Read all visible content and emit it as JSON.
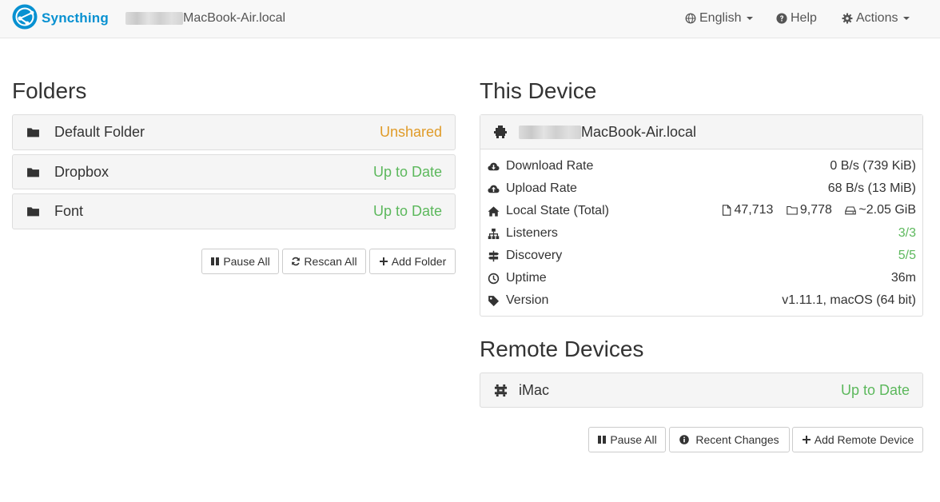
{
  "navbar": {
    "brand": "Syncthing",
    "hostname": "MacBook-Air.local",
    "language": "English",
    "help": "Help",
    "actions": "Actions"
  },
  "folders": {
    "title": "Folders",
    "items": [
      {
        "name": "Default Folder",
        "status": "Unshared"
      },
      {
        "name": "Dropbox",
        "status": "Up to Date"
      },
      {
        "name": "Font",
        "status": "Up to Date"
      }
    ],
    "buttons": {
      "pause_all": "Pause All",
      "rescan_all": "Rescan All",
      "add_folder": "Add Folder"
    }
  },
  "this_device": {
    "title": "This Device",
    "name": "MacBook-Air.local",
    "rows": {
      "download_rate": {
        "label": "Download Rate",
        "value": "0 B/s (739 KiB)"
      },
      "upload_rate": {
        "label": "Upload Rate",
        "value": "68 B/s (13 MiB)"
      },
      "local_state": {
        "label": "Local State (Total)",
        "files": "47,713",
        "dirs": "9,778",
        "size": "~2.05 GiB"
      },
      "listeners": {
        "label": "Listeners",
        "value": "3/3"
      },
      "discovery": {
        "label": "Discovery",
        "value": "5/5"
      },
      "uptime": {
        "label": "Uptime",
        "value": "36m"
      },
      "version": {
        "label": "Version",
        "value": "v1.11.1, macOS (64 bit)"
      }
    }
  },
  "remote_devices": {
    "title": "Remote Devices",
    "items": [
      {
        "name": "iMac",
        "status": "Up to Date"
      }
    ],
    "buttons": {
      "pause_all": "Pause All",
      "recent_changes": "Recent Changes",
      "add_remote_device": "Add Remote Device"
    }
  },
  "colors": {
    "brand": "#0891d1",
    "status_ok": "#5cb85c",
    "status_warning": "#e09b28"
  }
}
